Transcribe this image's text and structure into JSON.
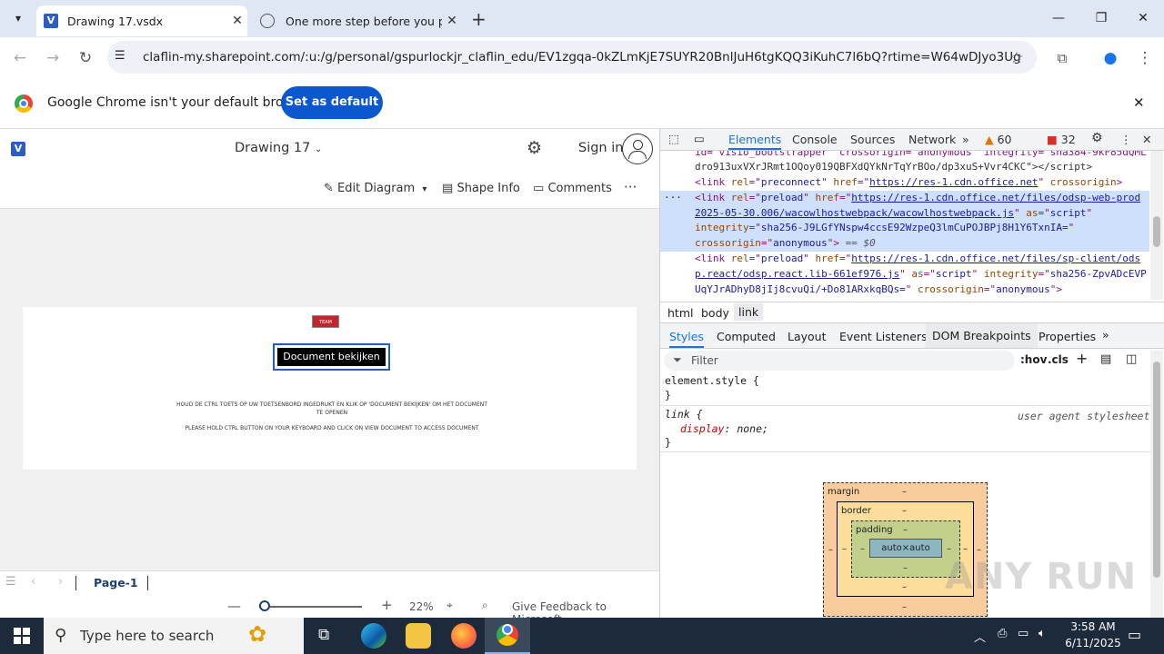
{
  "browser": {
    "tabs": [
      {
        "title": "Drawing 17.vsdx"
      },
      {
        "title": "One more step before you proc"
      }
    ],
    "url": "claflin-my.sharepoint.com/:u:/g/personal/gspurlockjr_claflin_edu/EV1zgqa-0kZLmKjE7SUYR20BnlJuH6tgKQQ3iKuhC7l6bQ?rtime=W64wDJyo3Ug",
    "banner_text": "Google Chrome isn't your default browser",
    "banner_button": "Set as default"
  },
  "visio": {
    "doc_title": "Drawing 17",
    "sign_in": "Sign in",
    "toolbar": {
      "edit": "Edit Diagram",
      "shape_info": "Shape Info",
      "comments": "Comments"
    },
    "drawing": {
      "logo": "TEAM",
      "button": "Document bekijken",
      "line1": "HOUD DE CTRL TOETS OP UW TOETSENBORD INGEDRUKT EN KLIK OP 'DOCUMENT BEKIJKEN' OM HET DOCUMENT",
      "line2": "TE OPENEN",
      "line3": "PLEASE HOLD CTRL BUTTON ON YOUR KEYBOARD AND CLICK ON VIEW DOCUMENT TO ACCESS DOCUMENT"
    },
    "page_tab": "Page-1",
    "zoom": "22%",
    "feedback": "Give Feedback to Microsoft"
  },
  "devtools": {
    "tabs": [
      "Elements",
      "Console",
      "Sources",
      "Network"
    ],
    "warnings": "60",
    "errors": "32",
    "crumbs": [
      "html",
      "body",
      "link"
    ],
    "style_tabs": [
      "Styles",
      "Computed",
      "Layout",
      "Event Listeners",
      "DOM Breakpoints",
      "Properties"
    ],
    "filter_placeholder": "Filter",
    "hov": ":hov",
    "cls": ".cls",
    "rule1": "element.style {",
    "rule2_sel": "link {",
    "rule2_prop": "display",
    "rule2_val": "none;",
    "rule2_src": "user agent stylesheet",
    "boxmodel": {
      "margin": "margin",
      "border": "border",
      "padding": "padding",
      "content": "auto×auto",
      "dash": "–"
    }
  },
  "taskbar": {
    "search": "Type here to search",
    "time": "3:58 AM",
    "date": "6/11/2025"
  },
  "watermark": "ANY RUN"
}
